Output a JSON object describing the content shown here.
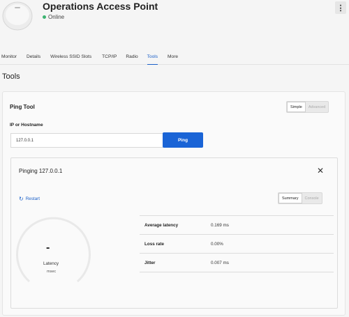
{
  "device": {
    "title": "Operations Access Point",
    "status": "Online",
    "status_color": "#3cb371",
    "menu_icon": "kebab-menu-icon"
  },
  "tabs": [
    {
      "label": "Monitor",
      "active": false
    },
    {
      "label": "Details",
      "active": false
    },
    {
      "label": "Wireless SSID Slots",
      "active": false
    },
    {
      "label": "TCP/IP",
      "active": false
    },
    {
      "label": "Radio",
      "active": false
    },
    {
      "label": "Tools",
      "active": true
    },
    {
      "label": "More",
      "active": false
    }
  ],
  "section": {
    "title": "Tools"
  },
  "ping_tool": {
    "title": "Ping Tool",
    "mode_toggle": {
      "simple": "Simple",
      "advanced": "Advanced",
      "selected": "Simple"
    },
    "field_label": "IP or Hostname",
    "field_value": "127.0.0.1",
    "ping_label": "Ping"
  },
  "result": {
    "title": "Pinging 127.0.0.1",
    "restart_label": "Restart",
    "view_toggle": {
      "summary": "Summary",
      "console": "Console",
      "selected": "Summary"
    },
    "gauge": {
      "value": "-",
      "label": "Latency",
      "unit": "msec"
    },
    "stats": [
      {
        "label": "Average latency",
        "value": "0.169 ms"
      },
      {
        "label": "Loss rate",
        "value": "0.00%"
      },
      {
        "label": "Jitter",
        "value": "0.007 ms"
      }
    ]
  },
  "colors": {
    "accent": "#1a64d6",
    "link": "#1a5fc8",
    "online": "#3cb371"
  }
}
